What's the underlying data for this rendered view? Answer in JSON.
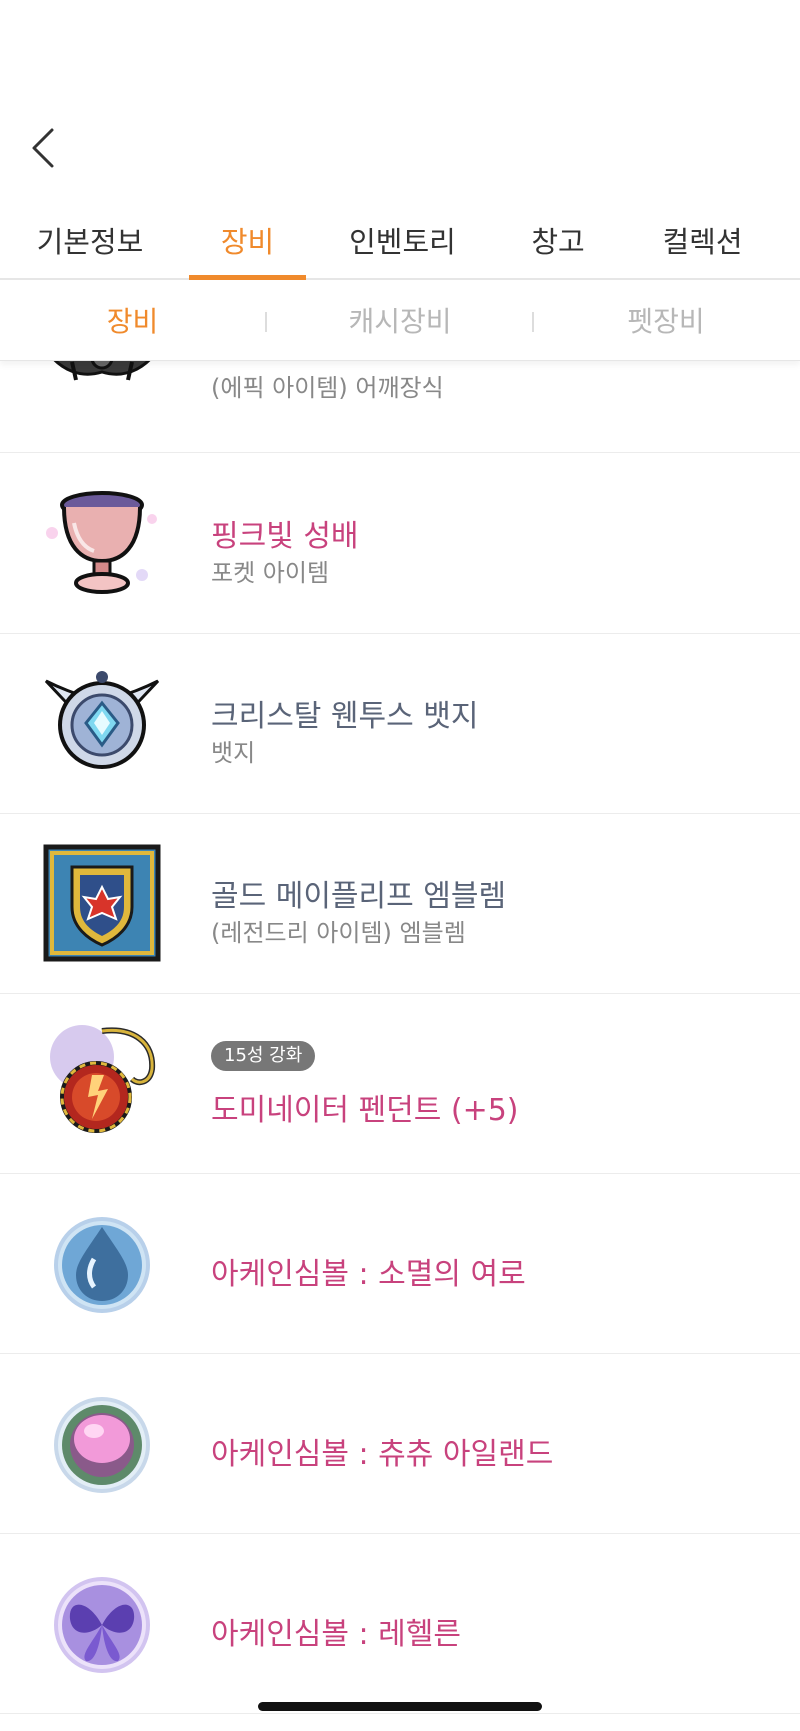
{
  "tabs": [
    {
      "label": "기본정보"
    },
    {
      "label": "장비"
    },
    {
      "label": "인벤토리"
    },
    {
      "label": "창고"
    },
    {
      "label": "컬렉션"
    }
  ],
  "active_tab": "장비",
  "subtabs": [
    {
      "label": "장비"
    },
    {
      "label": "캐시장비"
    },
    {
      "label": "펫장비"
    }
  ],
  "active_subtab": "장비",
  "items": [
    {
      "name": "",
      "type": "(에픽 아이템) 어깨장식",
      "badge": "",
      "icon": "shoulder-icon"
    },
    {
      "name": "핑크빛 성배",
      "type": "포켓 아이템",
      "badge": "",
      "icon": "chalice-icon"
    },
    {
      "name": "크리스탈 웬투스 뱃지",
      "type": "뱃지",
      "badge": "",
      "icon": "badge-icon"
    },
    {
      "name": "골드 메이플리프 엠블렘",
      "type": "(레전드리 아이템) 엠블렘",
      "badge": "",
      "icon": "emblem-icon"
    },
    {
      "name": "도미네이터 펜던트 (+5)",
      "type": "",
      "badge": "15성 강화",
      "icon": "pendant-icon"
    },
    {
      "name": "아케인심볼 : 소멸의 여로",
      "type": "",
      "badge": "",
      "icon": "symbol-icon"
    },
    {
      "name": "아케인심볼 : 츄츄 아일랜드",
      "type": "",
      "badge": "",
      "icon": "symbol-icon"
    },
    {
      "name": "아케인심볼 : 레헬른",
      "type": "",
      "badge": "",
      "icon": "symbol-icon"
    }
  ],
  "colors": {
    "accent": "#f08a2c",
    "item_name_pink": "#c8427d",
    "item_name_slate": "#5a6478",
    "badge_bg": "#777777"
  }
}
